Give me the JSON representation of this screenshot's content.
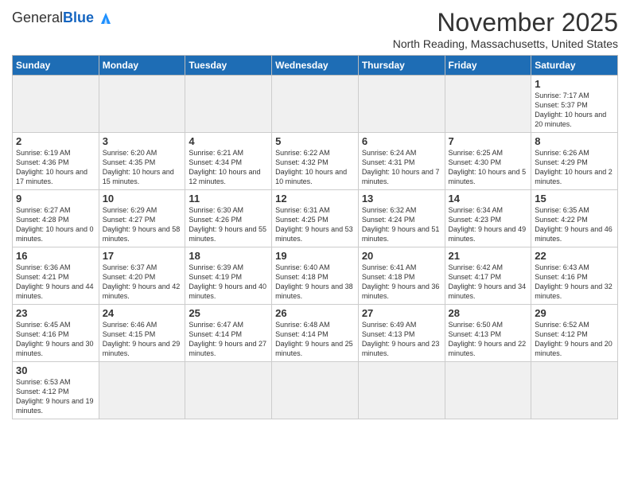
{
  "header": {
    "logo_general": "General",
    "logo_blue": "Blue",
    "month_title": "November 2025",
    "subtitle": "North Reading, Massachusetts, United States"
  },
  "days_of_week": [
    "Sunday",
    "Monday",
    "Tuesday",
    "Wednesday",
    "Thursday",
    "Friday",
    "Saturday"
  ],
  "weeks": [
    [
      {
        "day": "",
        "info": ""
      },
      {
        "day": "",
        "info": ""
      },
      {
        "day": "",
        "info": ""
      },
      {
        "day": "",
        "info": ""
      },
      {
        "day": "",
        "info": ""
      },
      {
        "day": "",
        "info": ""
      },
      {
        "day": "1",
        "info": "Sunrise: 7:17 AM\nSunset: 5:37 PM\nDaylight: 10 hours and 20 minutes."
      }
    ],
    [
      {
        "day": "2",
        "info": "Sunrise: 6:19 AM\nSunset: 4:36 PM\nDaylight: 10 hours and 17 minutes."
      },
      {
        "day": "3",
        "info": "Sunrise: 6:20 AM\nSunset: 4:35 PM\nDaylight: 10 hours and 15 minutes."
      },
      {
        "day": "4",
        "info": "Sunrise: 6:21 AM\nSunset: 4:34 PM\nDaylight: 10 hours and 12 minutes."
      },
      {
        "day": "5",
        "info": "Sunrise: 6:22 AM\nSunset: 4:32 PM\nDaylight: 10 hours and 10 minutes."
      },
      {
        "day": "6",
        "info": "Sunrise: 6:24 AM\nSunset: 4:31 PM\nDaylight: 10 hours and 7 minutes."
      },
      {
        "day": "7",
        "info": "Sunrise: 6:25 AM\nSunset: 4:30 PM\nDaylight: 10 hours and 5 minutes."
      },
      {
        "day": "8",
        "info": "Sunrise: 6:26 AM\nSunset: 4:29 PM\nDaylight: 10 hours and 2 minutes."
      }
    ],
    [
      {
        "day": "9",
        "info": "Sunrise: 6:27 AM\nSunset: 4:28 PM\nDaylight: 10 hours and 0 minutes."
      },
      {
        "day": "10",
        "info": "Sunrise: 6:29 AM\nSunset: 4:27 PM\nDaylight: 9 hours and 58 minutes."
      },
      {
        "day": "11",
        "info": "Sunrise: 6:30 AM\nSunset: 4:26 PM\nDaylight: 9 hours and 55 minutes."
      },
      {
        "day": "12",
        "info": "Sunrise: 6:31 AM\nSunset: 4:25 PM\nDaylight: 9 hours and 53 minutes."
      },
      {
        "day": "13",
        "info": "Sunrise: 6:32 AM\nSunset: 4:24 PM\nDaylight: 9 hours and 51 minutes."
      },
      {
        "day": "14",
        "info": "Sunrise: 6:34 AM\nSunset: 4:23 PM\nDaylight: 9 hours and 49 minutes."
      },
      {
        "day": "15",
        "info": "Sunrise: 6:35 AM\nSunset: 4:22 PM\nDaylight: 9 hours and 46 minutes."
      }
    ],
    [
      {
        "day": "16",
        "info": "Sunrise: 6:36 AM\nSunset: 4:21 PM\nDaylight: 9 hours and 44 minutes."
      },
      {
        "day": "17",
        "info": "Sunrise: 6:37 AM\nSunset: 4:20 PM\nDaylight: 9 hours and 42 minutes."
      },
      {
        "day": "18",
        "info": "Sunrise: 6:39 AM\nSunset: 4:19 PM\nDaylight: 9 hours and 40 minutes."
      },
      {
        "day": "19",
        "info": "Sunrise: 6:40 AM\nSunset: 4:18 PM\nDaylight: 9 hours and 38 minutes."
      },
      {
        "day": "20",
        "info": "Sunrise: 6:41 AM\nSunset: 4:18 PM\nDaylight: 9 hours and 36 minutes."
      },
      {
        "day": "21",
        "info": "Sunrise: 6:42 AM\nSunset: 4:17 PM\nDaylight: 9 hours and 34 minutes."
      },
      {
        "day": "22",
        "info": "Sunrise: 6:43 AM\nSunset: 4:16 PM\nDaylight: 9 hours and 32 minutes."
      }
    ],
    [
      {
        "day": "23",
        "info": "Sunrise: 6:45 AM\nSunset: 4:16 PM\nDaylight: 9 hours and 30 minutes."
      },
      {
        "day": "24",
        "info": "Sunrise: 6:46 AM\nSunset: 4:15 PM\nDaylight: 9 hours and 29 minutes."
      },
      {
        "day": "25",
        "info": "Sunrise: 6:47 AM\nSunset: 4:14 PM\nDaylight: 9 hours and 27 minutes."
      },
      {
        "day": "26",
        "info": "Sunrise: 6:48 AM\nSunset: 4:14 PM\nDaylight: 9 hours and 25 minutes."
      },
      {
        "day": "27",
        "info": "Sunrise: 6:49 AM\nSunset: 4:13 PM\nDaylight: 9 hours and 23 minutes."
      },
      {
        "day": "28",
        "info": "Sunrise: 6:50 AM\nSunset: 4:13 PM\nDaylight: 9 hours and 22 minutes."
      },
      {
        "day": "29",
        "info": "Sunrise: 6:52 AM\nSunset: 4:12 PM\nDaylight: 9 hours and 20 minutes."
      }
    ],
    [
      {
        "day": "30",
        "info": "Sunrise: 6:53 AM\nSunset: 4:12 PM\nDaylight: 9 hours and 19 minutes."
      },
      {
        "day": "",
        "info": ""
      },
      {
        "day": "",
        "info": ""
      },
      {
        "day": "",
        "info": ""
      },
      {
        "day": "",
        "info": ""
      },
      {
        "day": "",
        "info": ""
      },
      {
        "day": "",
        "info": ""
      }
    ]
  ]
}
